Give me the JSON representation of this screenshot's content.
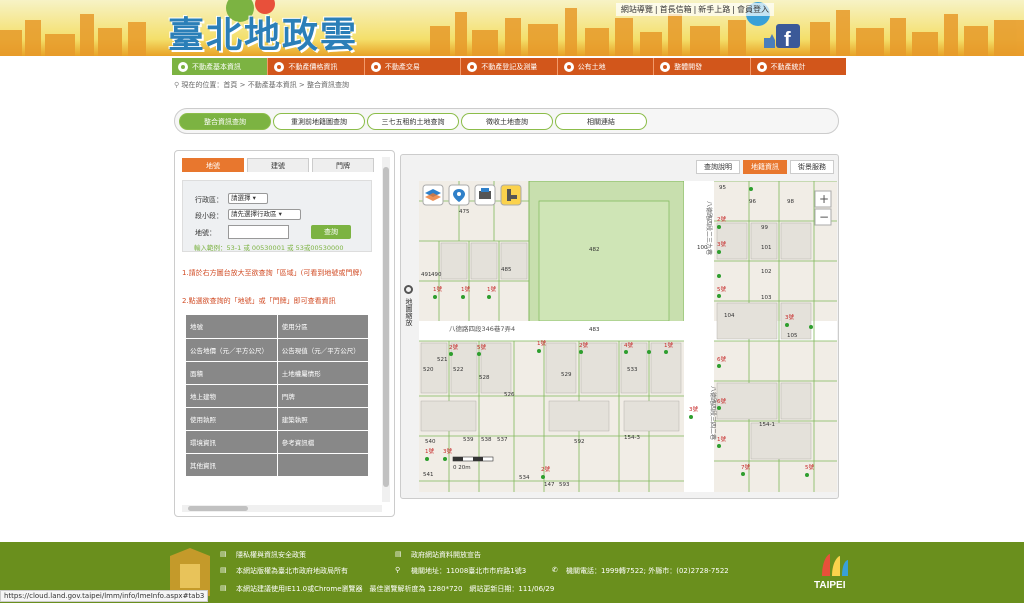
{
  "header": {
    "logo_text": "臺北地政雲",
    "top_links": [
      "網站導覽",
      "首長信箱",
      "新手上路",
      "會員登入"
    ],
    "fb_icon": "facebook-icon"
  },
  "nav": [
    {
      "label": "不動產基本資訊",
      "icon": "info-icon",
      "active": true
    },
    {
      "label": "不動產價格資訊",
      "icon": "price-icon",
      "active": false
    },
    {
      "label": "不動產交易",
      "icon": "house-icon",
      "active": false
    },
    {
      "label": "不動產登記及測量",
      "icon": "register-icon",
      "active": false
    },
    {
      "label": "公有土地",
      "icon": "land-icon",
      "active": false
    },
    {
      "label": "整體開發",
      "icon": "develop-icon",
      "active": false
    },
    {
      "label": "不動產統計",
      "icon": "stats-icon",
      "active": false
    }
  ],
  "breadcrumb": {
    "prefix": "現在的位置：",
    "path": "首頁 > 不動產基本資訊 > 整合資訊查詢"
  },
  "subtabs": [
    "整合資訊查詢",
    "重測前地籍圖查詢",
    "三七五租約土地查詢",
    "徵收土地查詢",
    "相關連結"
  ],
  "left": {
    "tabs": [
      "地號",
      "建號",
      "門牌"
    ],
    "district_label": "行政區：",
    "district_value": "請選擇",
    "section_label": "段小段：",
    "section_value": "請先選擇行政區",
    "land_label": "地號：",
    "land_placeholder": "",
    "query_btn": "查詢",
    "example": "輸入範例：53-1 或 00530001 或 53或00530000",
    "note1": "1.請於右方圖台放大至欲查詢「區域」(可看到地號或門牌)",
    "note2": "2.點選欲查詢的「地號」或「門牌」即可查看資訊",
    "table": [
      [
        "地號",
        "使用分區"
      ],
      [
        "公告地價（元／平方公尺）",
        "公告現值（元／平方公尺）"
      ],
      [
        "面積",
        "土地權屬情形"
      ],
      [
        "地上建物",
        "門牌"
      ],
      [
        "使用執照",
        "建築執照"
      ],
      [
        "環境資訊",
        "參考資訊檔"
      ],
      [
        "其他資訊",
        ""
      ]
    ]
  },
  "map": {
    "tabs": [
      "查詢說明",
      "地籍資訊",
      "街景服務"
    ],
    "active_tab": 1,
    "side_label": "地圖縮放",
    "road1": "八德路四段346巷7弄4",
    "road2": "八德路四段二三九巷",
    "road3": "八德路四段三四二巷",
    "scale": "0    20m",
    "parcels": [
      "475",
      "482",
      "483",
      "485",
      "491",
      "490",
      "520",
      "522",
      "529",
      "533",
      "537",
      "538",
      "539",
      "540",
      "534",
      "154-3",
      "154-1",
      "101",
      "102",
      "103",
      "104",
      "99",
      "96",
      "95",
      "98",
      "105",
      "100",
      "521",
      "528",
      "526",
      "541",
      "593",
      "592",
      "147"
    ],
    "door_labels": [
      "1號",
      "1號",
      "1號",
      "2號",
      "5號",
      "1號",
      "2號",
      "4號",
      "1號",
      "2號",
      "3號",
      "5號",
      "6號",
      "7號",
      "3號",
      "1號",
      "3號",
      "2號",
      "5號",
      "1號",
      "6號",
      "3號"
    ]
  },
  "footer": {
    "privacy": "隱私權與資訊安全政策",
    "open_data": "政府網站資料開放宣告",
    "copyright": "本網站版權為臺北市政府地政局所有",
    "address": "機關地址：11008臺北市市府路1號3",
    "phone": "機關電話：1999轉7522; 外縣市：(02)2728-7522",
    "browser": "本網站建議使用IE11.0或Chrome瀏覽器　最佳瀏覽解析度為 1280*720　網站更新日期：111/06/29",
    "taipei_logo": "TAIPEI"
  },
  "statusbar": "https://cloud.land.gov.taipei/lmm/info/lmeInfo.aspx#tab3"
}
